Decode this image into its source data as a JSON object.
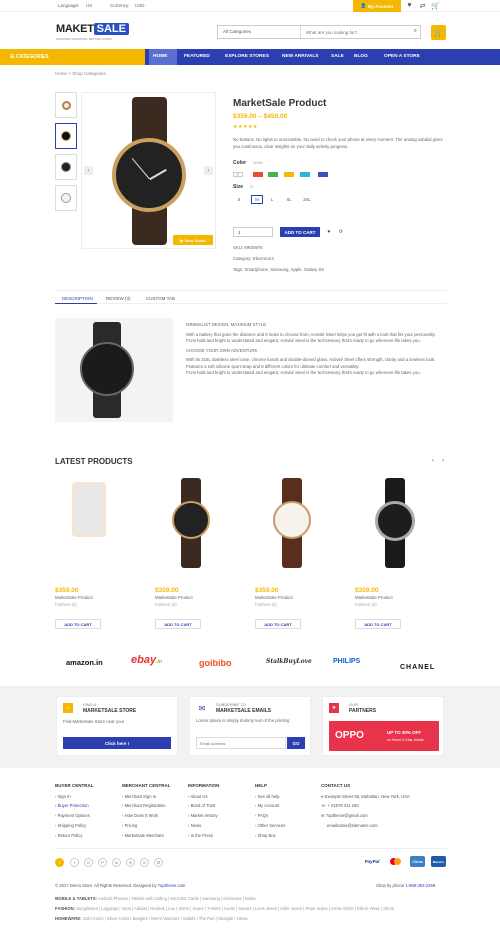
{
  "topbar": {
    "language": "Language:",
    "lang_val": "US",
    "currency": "Currency:",
    "curr_val": "USD",
    "account": "My Account"
  },
  "logo": {
    "part1": "MAKET",
    "part2": "SALE",
    "tagline": "SMARTER SHOPPING, BETTER LIVING!"
  },
  "search": {
    "category": "All Categories",
    "placeholder": "What are you looking for?"
  },
  "nav": {
    "categories": "CATEGORIES",
    "items": [
      "HOME",
      "FEATURED",
      "EXPLORE STORES",
      "NEW ARRIVALS",
      "SALE",
      "BLOG",
      "OPEN A STORE"
    ]
  },
  "breadcrumb": {
    "home": "Home",
    "sep": ">",
    "current": "Shop Categories"
  },
  "product": {
    "title": "MarketSale Product",
    "price": "$359.00 – $450.00",
    "stars": "★★★★★",
    "desc": "No buttons. No lights to unscramble. No need to check your phone at every moment. The analog subdial gives you continuous, clear insights on your daily activity progress.",
    "color_label": "Color",
    "color_val": "White",
    "size_label": "Size",
    "size_val": "M",
    "sizes": [
      "S",
      "M",
      "L",
      "XL",
      "2XL"
    ],
    "qty": "1",
    "add": "ADD TO CART",
    "sku_label": "SKU:",
    "sku": "MK00976",
    "cat_label": "Category:",
    "category": "Electronics",
    "tags_label": "Tags:",
    "tags": "Smartphone, Samsung, Apple, Galaxy S8",
    "view_video": "View Video"
  },
  "tabs": {
    "description": "DESCRIPTION",
    "review": "REVIEW (3)",
    "custom": "CUSTOM TAB"
  },
  "description": {
    "h1": "MINIMALIST DESIGN. MAXIMUM STYLE.",
    "p1": "With a battery that goes the distance and 9 looks to choose from, Activité Steel helps you get fit with a look that fits your personality. From bold and bright to understated and elegant, Activité Steel is the techcessory that's ready to go wherever life takes you.",
    "h2": "CHOOSE YOUR OWN ADVENTURE",
    "p2": "With its 316L stainless steel case, chrome hands and double-domed glass, Activité Steel offers strength, clarity and a timeless look. Features a soft silicone sport strap and 9 different colors for ultimate comfort and versatility.",
    "p3": "From bold and bright to understated and elegant, Activité Steel is the techcessory that's ready to go wherever life takes you."
  },
  "latest": {
    "title": "LATEST PRODUCTS",
    "items": [
      {
        "price": "$359.00",
        "name": "MarketSale Product",
        "cat": "Fashion (6)",
        "btn": "ADD TO CART"
      },
      {
        "price": "$359.00",
        "name": "MarketSale Product",
        "cat": "Fashion (6)",
        "btn": "ADD TO CART"
      },
      {
        "price": "$359.00",
        "name": "MarketSale Product",
        "cat": "Fashion (6)",
        "btn": "ADD TO CART"
      },
      {
        "price": "$359.00",
        "name": "MarketSale Product",
        "cat": "Fashion (6)",
        "btn": "ADD TO CART"
      }
    ]
  },
  "brands": [
    "amazon.in",
    "ebay",
    "goibibo",
    "StalkBuyLove",
    "PHILIPS",
    "CHANEL"
  ],
  "brand_sub": {
    "amazon": ".in",
    "ebay": ".in"
  },
  "boxes": {
    "find_small": "FIND A",
    "find_big": "MARKETSALE STORE",
    "find_text": "Find Marketsale Store near you!",
    "find_btn": "Click here !",
    "sub_small": "SUBSCRIBE TO",
    "sub_big": "MARKETSALE EMAILS",
    "sub_text": "Lorem Ipsum is simply dummy text of the printing",
    "sub_placeholder": "Email address",
    "sub_btn": "GO",
    "our_small": "OUR",
    "our_big": "PARTNERS",
    "oppo": "OPPO",
    "oppo_off": "UP TO 30% OFF",
    "oppo_sub": "on Home & Kids, Adults"
  },
  "footer": {
    "cols": [
      {
        "head": "BUYER CENTRAL",
        "items": [
          "Sign In",
          "Buyer Protection",
          "Payment Options",
          "Shipping Policy",
          "Return Policy"
        ]
      },
      {
        "head": "MERCHANT CENTRAL",
        "items": [
          "Merchant Sign In",
          "Merchant Registration",
          "How Does It Work",
          "Pricing",
          "Marketsale Merchant"
        ]
      },
      {
        "head": "INFORMATION",
        "items": [
          "About Us",
          "Bond of Trust",
          "Market History",
          "News",
          "In the Press"
        ]
      },
      {
        "head": "HELP",
        "items": [
          "See all help",
          "My Account",
          "FAQs",
          "Other Services",
          "Shop Box"
        ]
      }
    ],
    "contact_head": "CONTACT US",
    "address": "Example Street 68, Mahattan, New York, USA",
    "phone": "+ 01678 311 160",
    "email1": "7uptheme@gmail.com",
    "email2": "emailname@sitename.com"
  },
  "payments": [
    "PayPal",
    "MC",
    "Cirrus",
    "Maestro"
  ],
  "copyright": "© 2017 Demo Store. All Rights Reserved. Designed by ",
  "designer": "7uptheme.com",
  "shop_phone": "Shop by phone",
  "shop_num": "1-899-353-2268",
  "bottom_links": [
    {
      "label": "MOBILE & TABLETS:",
      "text": "Android Phones | Tablets with Calling | MicroSD Cards | Samsung | Micromax | Nokia"
    },
    {
      "label": "FASHION:",
      "text": "Sunglasses | Leggings | Vans | Adidas | Reebok | Lux | Shirts | Jeans | T-shirts | Kurtis | Sarees | Levis Jeans | Killer Jeans | Pepe Jeans | Arrow Shirts | Ethnic Wear | Shirts"
    },
    {
      "label": "HOMEWARE:",
      "text": "Gold Coins | Silver Coins | Bangles | Men's Watches | Sukkhi | The Pari | Gitanjali | Oleva"
    }
  ],
  "colors": {
    "yellow": "#f5b800",
    "blue": "#2c3fb1"
  },
  "swatches": [
    "#ffffff",
    "#e74c3c",
    "#4caf50",
    "#f5b800",
    "#2fb5d8",
    "#3f51b5"
  ]
}
